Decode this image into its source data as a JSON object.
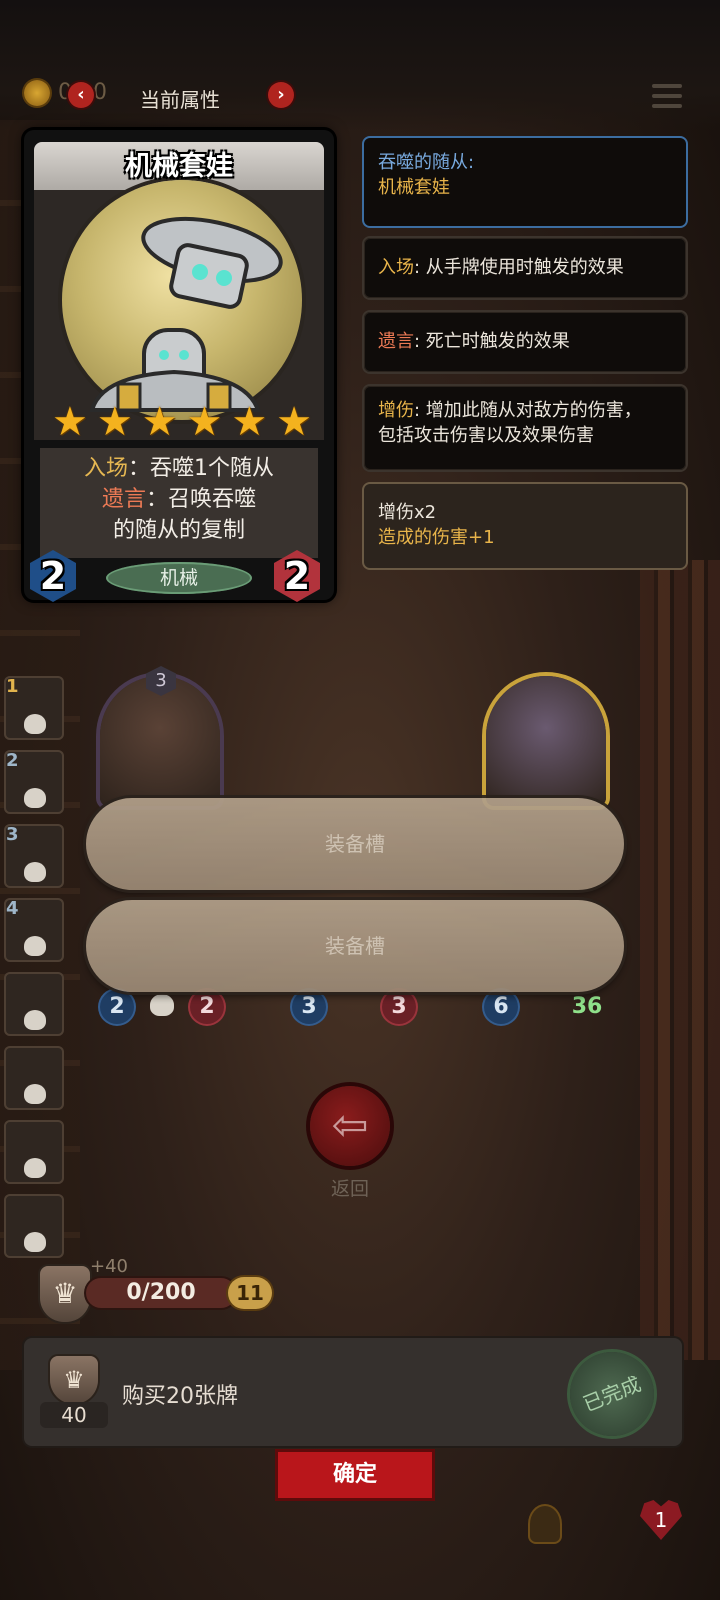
{
  "header": {
    "coins": "0 20",
    "title": "当前属性",
    "prev_icon": "chevron-left-icon",
    "next_icon": "chevron-right-icon",
    "menu_icon": "menu-icon"
  },
  "roster": {
    "items": [
      {
        "num": "1"
      },
      {
        "num": "2"
      },
      {
        "num": "3"
      },
      {
        "num": "4"
      },
      {
        "num": ""
      },
      {
        "num": ""
      },
      {
        "num": ""
      },
      {
        "num": ""
      }
    ]
  },
  "card": {
    "name": "机械套娃",
    "stars": 6,
    "line1_kw": "入场",
    "line1_text": "：吞噬1个随从",
    "line2_kw": "遗言",
    "line2_text": "：召唤吞噬",
    "line3_text": "的随从的复制",
    "tribe": "机械",
    "attack": "2",
    "health": "2"
  },
  "panels": {
    "devoured_label": "吞噬的随从:",
    "devoured_name": "机械套娃",
    "battlecry_kw": "入场",
    "battlecry_desc": ": 从手牌使用时触发的效果",
    "deathrattle_kw": "遗言",
    "deathrattle_desc": ": 死亡时触发的效果",
    "dmgup_kw": "增伤",
    "dmgup_desc": ": 增加此随从对敌方的伤害，",
    "dmgup_desc2": "包括攻击伤害以及效果伤害",
    "buff_title": "增伤x2",
    "buff_desc": "造成的伤害+1"
  },
  "board": {
    "minion1_level": "3",
    "row_stats": [
      "2",
      "2",
      "3",
      "3",
      "6",
      "36"
    ]
  },
  "slots": {
    "slot1": "装备槽",
    "slot2": "装备槽"
  },
  "back": {
    "label": "返回"
  },
  "progress": {
    "bonus": "+40",
    "text": "0/200",
    "fraction": 0.0,
    "level": "11"
  },
  "task": {
    "reward": "40",
    "text": "购买20张牌",
    "status": "已完成"
  },
  "confirm_label": "确定",
  "lives": "1"
}
